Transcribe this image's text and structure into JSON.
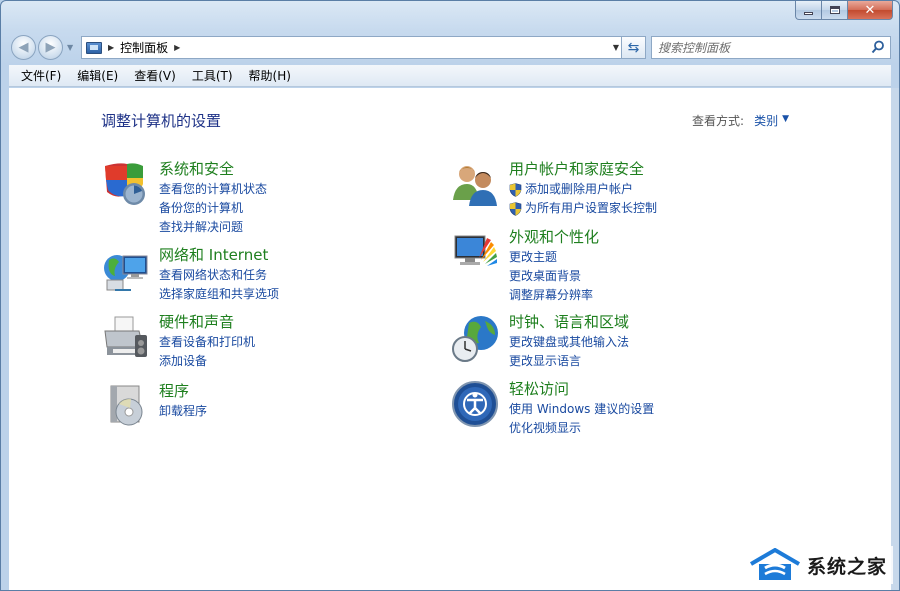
{
  "window": {
    "address_path": "控制面板",
    "search_placeholder": "搜索控制面板"
  },
  "menu": [
    "文件(F)",
    "编辑(E)",
    "查看(V)",
    "工具(T)",
    "帮助(H)"
  ],
  "page": {
    "heading": "调整计算机的设置",
    "view_by_label": "查看方式:",
    "view_by_value": "类别"
  },
  "categories": [
    {
      "title": "系统和安全",
      "icon": "system-security-icon",
      "links": [
        "查看您的计算机状态",
        "备份您的计算机",
        "查找并解决问题"
      ]
    },
    {
      "title": "网络和 Internet",
      "icon": "network-icon",
      "links": [
        "查看网络状态和任务",
        "选择家庭组和共享选项"
      ]
    },
    {
      "title": "硬件和声音",
      "icon": "hardware-printer-icon",
      "links": [
        "查看设备和打印机",
        "添加设备"
      ]
    },
    {
      "title": "程序",
      "icon": "programs-icon",
      "links": [
        "卸载程序"
      ]
    },
    {
      "title": "用户帐户和家庭安全",
      "icon": "users-icon",
      "links": [
        "添加或删除用户帐户",
        "为所有用户设置家长控制"
      ]
    },
    {
      "title": "外观和个性化",
      "icon": "appearance-icon",
      "links": [
        "更改主题",
        "更改桌面背景",
        "调整屏幕分辨率"
      ]
    },
    {
      "title": "时钟、语言和区域",
      "icon": "clock-globe-icon",
      "links": [
        "更改键盘或其他输入法",
        "更改显示语言"
      ]
    },
    {
      "title": "轻松访问",
      "icon": "ease-of-access-icon",
      "links": [
        "使用 Windows 建议的设置",
        "优化视频显示"
      ]
    }
  ],
  "watermark": "系统之家",
  "colors": {
    "category_title": "#1e7f1e",
    "link": "#1a4aa0",
    "heading": "#1e3287"
  }
}
